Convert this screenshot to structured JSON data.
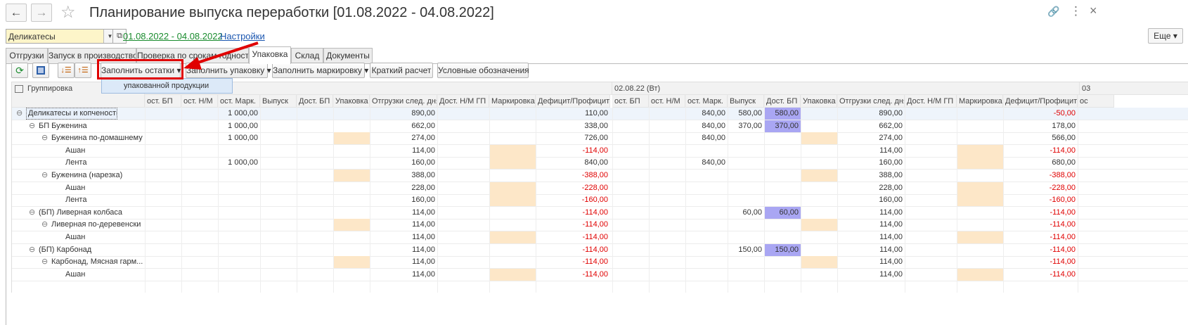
{
  "window": {
    "title": "Планирование выпуска переработки [01.08.2022 - 04.08.2022]",
    "back_icon": "←",
    "forward_icon": "→",
    "star_icon": "☆",
    "link_icon": "🔗",
    "menu_icon": "⋮",
    "close_icon": "×"
  },
  "filters": {
    "group_value": "Деликатесы",
    "period_link": "01.08.2022 - 04.08.2022",
    "settings_link": "Настройки",
    "more_button": "Еще ▾"
  },
  "tabs": [
    "Отгрузки",
    "Запуск в производство",
    "Проверка по срокам годности",
    "Упаковка",
    "Склад",
    "Документы"
  ],
  "active_tab": 3,
  "toolbar": {
    "fill_remains": "Заполнить остатки ▾",
    "fill_packaging": "Заполнить упаковку ▾",
    "fill_marking": "Заполнить маркировку ▾",
    "brief_calc": "Краткий расчет",
    "legend": "Условные обозначения",
    "dropdown_item": "упакованной продукции"
  },
  "colors": {
    "accent_red": "#e00000",
    "peach": "#fde7c8",
    "purple": "#a9a6f3",
    "link_green": "#1a8c2e",
    "link_blue": "#1a56b0"
  },
  "table": {
    "group_header": "Группировка",
    "date_group_2": "02.08.22 (Вт)",
    "date_group_3": "03",
    "col_headers_1": [
      "ост. БП",
      "ост. Н/М",
      "ост. Марк.",
      "Выпуск",
      "Дост. БП",
      "Упаковка",
      "Отгрузки след. дня",
      "Дост. Н/М ГП",
      "Маркировка",
      "Дефицит/Профицит"
    ],
    "col_headers_2": [
      "ост. БП",
      "ост. Н/М",
      "ост. Марк.",
      "Выпуск",
      "Дост. БП",
      "Упаковка",
      "Отгрузки след. дня",
      "Дост. Н/М ГП",
      "Маркировка",
      "Дефицит/Профицит",
      "ос"
    ],
    "rows": [
      {
        "name": "Деликатесы и копчености",
        "level": 0,
        "toggle": "⊖",
        "v1": [
          "",
          "",
          "1 000,00",
          "",
          "",
          "",
          "890,00",
          "",
          "",
          "110,00"
        ],
        "v2": [
          "",
          "",
          "840,00",
          "580,00",
          "580,00",
          "",
          "890,00",
          "",
          "",
          "-50,00"
        ]
      },
      {
        "name": "БП Буженина",
        "level": 1,
        "toggle": "⊖",
        "v1": [
          "",
          "",
          "1 000,00",
          "",
          "",
          "",
          "662,00",
          "",
          "",
          "338,00"
        ],
        "v2": [
          "",
          "",
          "840,00",
          "370,00",
          "370,00",
          "",
          "662,00",
          "",
          "",
          "178,00"
        ]
      },
      {
        "name": "Буженина по-домашнему",
        "level": 2,
        "toggle": "⊖",
        "v1": [
          "",
          "",
          "1 000,00",
          "",
          "",
          "",
          "274,00",
          "",
          "",
          "726,00"
        ],
        "v2": [
          "",
          "",
          "840,00",
          "",
          "",
          "",
          "274,00",
          "",
          "",
          "566,00"
        ]
      },
      {
        "name": "Ашан",
        "level": 3,
        "toggle": "",
        "v1": [
          "",
          "",
          "",
          "",
          "",
          "",
          "114,00",
          "",
          "",
          "-114,00"
        ],
        "v2": [
          "",
          "",
          "",
          "",
          "",
          "",
          "114,00",
          "",
          "",
          "-114,00"
        ]
      },
      {
        "name": "Лента",
        "level": 3,
        "toggle": "",
        "v1": [
          "",
          "",
          "1 000,00",
          "",
          "",
          "",
          "160,00",
          "",
          "",
          "840,00"
        ],
        "v2": [
          "",
          "",
          "840,00",
          "",
          "",
          "",
          "160,00",
          "",
          "",
          "680,00"
        ]
      },
      {
        "name": "Буженина (нарезка)",
        "level": 2,
        "toggle": "⊖",
        "v1": [
          "",
          "",
          "",
          "",
          "",
          "",
          "388,00",
          "",
          "",
          "-388,00"
        ],
        "v2": [
          "",
          "",
          "",
          "",
          "",
          "",
          "388,00",
          "",
          "",
          "-388,00"
        ]
      },
      {
        "name": "Ашан",
        "level": 3,
        "toggle": "",
        "v1": [
          "",
          "",
          "",
          "",
          "",
          "",
          "228,00",
          "",
          "",
          "-228,00"
        ],
        "v2": [
          "",
          "",
          "",
          "",
          "",
          "",
          "228,00",
          "",
          "",
          "-228,00"
        ]
      },
      {
        "name": "Лента",
        "level": 3,
        "toggle": "",
        "v1": [
          "",
          "",
          "",
          "",
          "",
          "",
          "160,00",
          "",
          "",
          "-160,00"
        ],
        "v2": [
          "",
          "",
          "",
          "",
          "",
          "",
          "160,00",
          "",
          "",
          "-160,00"
        ]
      },
      {
        "name": "(БП) Ливерная колбаса",
        "level": 1,
        "toggle": "⊖",
        "v1": [
          "",
          "",
          "",
          "",
          "",
          "",
          "114,00",
          "",
          "",
          "-114,00"
        ],
        "v2": [
          "",
          "",
          "",
          "60,00",
          "60,00",
          "",
          "114,00",
          "",
          "",
          "-114,00"
        ]
      },
      {
        "name": "Ливерная по-деревенски",
        "level": 2,
        "toggle": "⊖",
        "v1": [
          "",
          "",
          "",
          "",
          "",
          "",
          "114,00",
          "",
          "",
          "-114,00"
        ],
        "v2": [
          "",
          "",
          "",
          "",
          "",
          "",
          "114,00",
          "",
          "",
          "-114,00"
        ]
      },
      {
        "name": "Ашан",
        "level": 3,
        "toggle": "",
        "v1": [
          "",
          "",
          "",
          "",
          "",
          "",
          "114,00",
          "",
          "",
          "-114,00"
        ],
        "v2": [
          "",
          "",
          "",
          "",
          "",
          "",
          "114,00",
          "",
          "",
          "-114,00"
        ]
      },
      {
        "name": "(БП) Карбонад",
        "level": 1,
        "toggle": "⊖",
        "v1": [
          "",
          "",
          "",
          "",
          "",
          "",
          "114,00",
          "",
          "",
          "-114,00"
        ],
        "v2": [
          "",
          "",
          "",
          "150,00",
          "150,00",
          "",
          "114,00",
          "",
          "",
          "-114,00"
        ]
      },
      {
        "name": "Карбонад, Мясная гарм...",
        "level": 2,
        "toggle": "⊖",
        "v1": [
          "",
          "",
          "",
          "",
          "",
          "",
          "114,00",
          "",
          "",
          "-114,00"
        ],
        "v2": [
          "",
          "",
          "",
          "",
          "",
          "",
          "114,00",
          "",
          "",
          "-114,00"
        ]
      },
      {
        "name": "Ашан",
        "level": 3,
        "toggle": "",
        "v1": [
          "",
          "",
          "",
          "",
          "",
          "",
          "114,00",
          "",
          "",
          "-114,00"
        ],
        "v2": [
          "",
          "",
          "",
          "",
          "",
          "",
          "114,00",
          "",
          "",
          "-114,00"
        ]
      }
    ]
  }
}
